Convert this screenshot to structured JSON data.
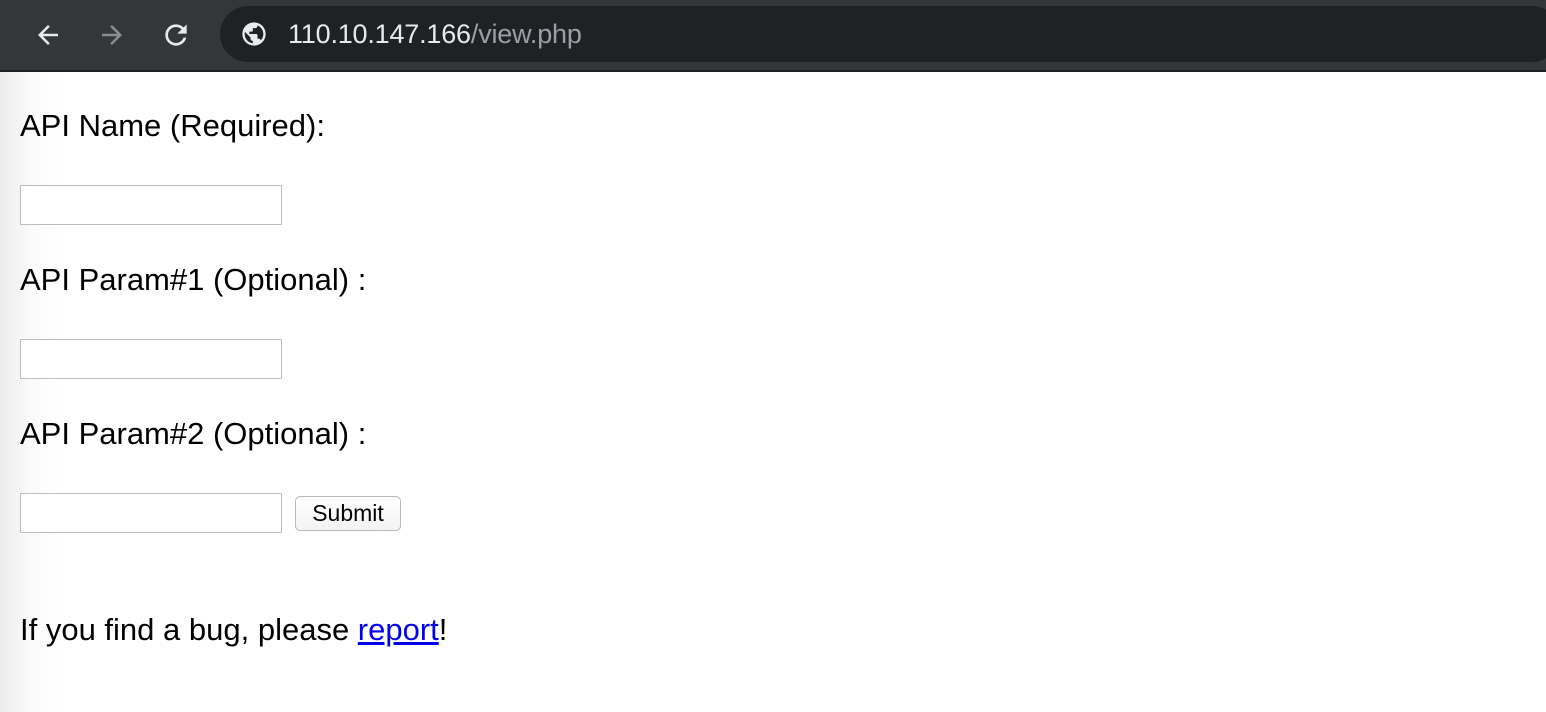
{
  "browser": {
    "url_host": "110.10.147.166",
    "url_path": "/view.php",
    "icons": {
      "back": "back-arrow-icon",
      "forward": "forward-arrow-icon",
      "reload": "reload-icon",
      "site_info": "globe-icon"
    }
  },
  "form": {
    "api_name_label": "API Name (Required):",
    "param1_label": "API Param#1 (Optional) :",
    "param2_label": "API Param#2 (Optional) :",
    "api_name_value": "",
    "param1_value": "",
    "param2_value": "",
    "submit_label": "Submit"
  },
  "footer": {
    "text_before": "If you find a bug, please ",
    "link_text": "report",
    "text_after": "!"
  },
  "colors": {
    "toolbar": "#35363a",
    "omnibox": "#202124",
    "link": "#0000ee"
  }
}
